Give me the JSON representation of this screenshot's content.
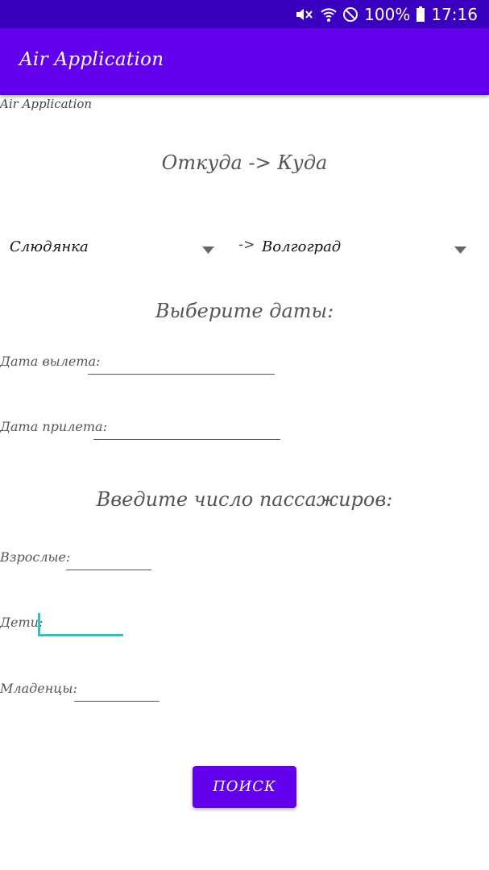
{
  "status_bar": {
    "battery": "100%",
    "time": "17:16",
    "icons": [
      "mute-icon",
      "wifi-icon",
      "do-not-disturb-icon",
      "battery-icon"
    ]
  },
  "app_bar": {
    "title": "Air Application"
  },
  "label_title": "Air Application",
  "route": {
    "heading": "Откуда -> Куда",
    "from": "Слюдянка",
    "separator": "->",
    "to": "Волгоград"
  },
  "dates": {
    "heading": "Выберите даты:",
    "departure_label": "Дата вылета:",
    "departure_value": "",
    "arrival_label": "Дата прилета:",
    "arrival_value": ""
  },
  "passengers": {
    "heading": "Введите число пассажиров:",
    "adults_label": "Взрослые:",
    "adults_value": "",
    "children_label": "Дети:",
    "children_value": "",
    "infants_label": "Младенцы:",
    "infants_value": ""
  },
  "search_button": "ПОИСК",
  "colors": {
    "status_bar": "#3a00c0",
    "primary": "#6200ee",
    "accent": "#26c6b8"
  }
}
